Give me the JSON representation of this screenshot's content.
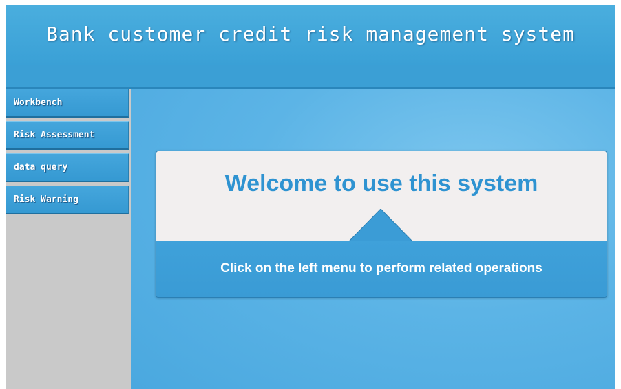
{
  "header": {
    "title": "Bank customer credit risk management system"
  },
  "sidebar": {
    "items": [
      {
        "label": "Workbench"
      },
      {
        "label": "Risk Assessment"
      },
      {
        "label": "data query"
      },
      {
        "label": "Risk Warning"
      }
    ]
  },
  "main": {
    "welcome_title": "Welcome to use this system",
    "welcome_subtitle": "Click on the left menu to perform related operations"
  },
  "colors": {
    "header_blue": "#4aaede",
    "menu_blue": "#3aa0d6",
    "sidebar_gray": "#c9c9c9",
    "card_light": "#f2efef",
    "title_blue": "#2f93d1"
  }
}
